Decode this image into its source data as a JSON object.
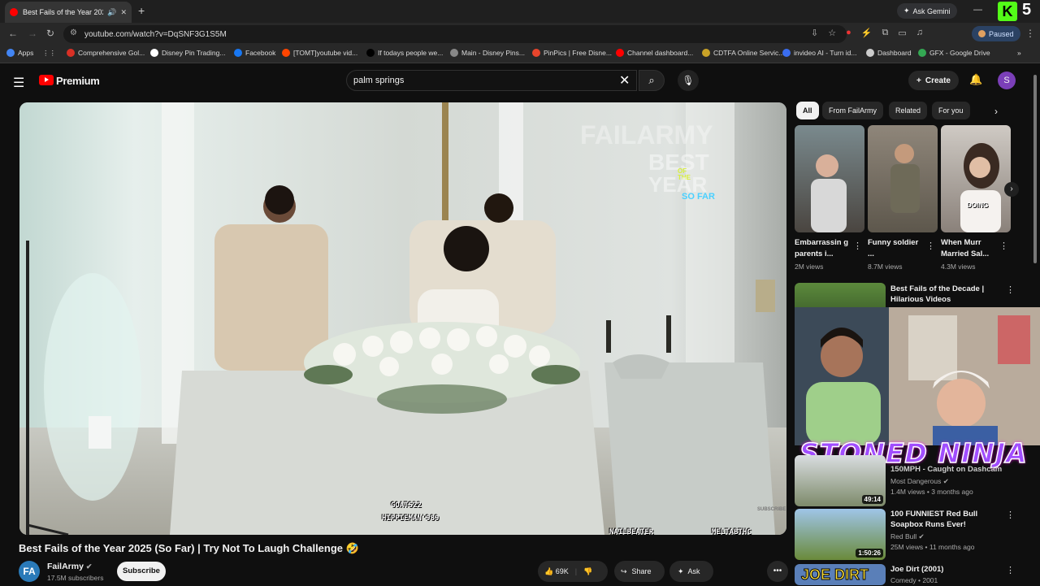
{
  "browser": {
    "tab_title": "Best Fails of the Year 2025 |",
    "url": "youtube.com/watch?v=DqSNF3G1S5M",
    "ask_gemini": "Ask Gemini",
    "paused": "Paused",
    "corner_badge": "5",
    "bookmarks": [
      {
        "label": "Apps",
        "color": "#4285f4"
      },
      {
        "label": "Comprehensive Gol...",
        "color": "#d93025"
      },
      {
        "label": "Disney Pin Trading...",
        "color": "#ffffff"
      },
      {
        "label": "Facebook",
        "color": "#1877f2"
      },
      {
        "label": "[TOMT]youtube vid...",
        "color": "#ff4500"
      },
      {
        "label": "If todays people we...",
        "color": "#000000"
      },
      {
        "label": "Main - Disney Pins...",
        "color": "#888888"
      },
      {
        "label": "PinPics | Free Disne...",
        "color": "#e8452c"
      },
      {
        "label": "Channel dashboard...",
        "color": "#ff0000"
      },
      {
        "label": "CDTFA Online Servic...",
        "color": "#c9a227"
      },
      {
        "label": "invideo AI - Turn id...",
        "color": "#3a6df0"
      },
      {
        "label": "Dashboard",
        "color": "#cccccc"
      },
      {
        "label": "GFX - Google Drive",
        "color": "#34a853"
      }
    ]
  },
  "youtube": {
    "logo_text": "Premium",
    "search_value": "palm springs",
    "create_label": "Create",
    "avatar_letter": "S"
  },
  "video": {
    "overlay_brand": "FAILARMY",
    "overlay_best": "BEST",
    "overlay_of": "OF",
    "overlay_the": "THE",
    "overlay_year": "YEAR",
    "overlay_sofar": "SO FAR",
    "title": "Best Fails of the Year 2025 (So Far) | Try Not To Laugh Challenge 🤣",
    "channel": "FailArmy",
    "subscribers": "17.5M subscribers",
    "subscribe_label": "Subscribe",
    "likes": "69K",
    "share_label": "Share",
    "ask_label": "Ask",
    "subscribe_watermark": "SUBSCRIBE",
    "game_tags": [
      "GOATS22",
      "HIPPIEMAN'989",
      "NAILBEATER",
      "MELTABTHC"
    ]
  },
  "chips": [
    "All",
    "From FailArmy",
    "Related",
    "For you"
  ],
  "shorts": [
    {
      "title": "Embarrassin g parents i...",
      "views": "2M views",
      "caption": ""
    },
    {
      "title": "Funny soldier ...",
      "views": "8.7M views",
      "caption": ""
    },
    {
      "title": "When Murr Married Sal...",
      "views": "4.3M views",
      "caption": "DOING"
    }
  ],
  "recommended": [
    {
      "title": "Best Fails of the Decade | Hilarious Videos",
      "channel": "",
      "meta": "",
      "duration": ""
    },
    {
      "title": "150MPH - Caught on Dashcam",
      "channel": "Most Dangerous",
      "meta": "1.4M views • 3 months ago",
      "duration": "49:14"
    },
    {
      "title": "100 FUNNIEST Red Bull Soapbox Runs Ever!",
      "channel": "Red Bull",
      "meta": "25M views • 11 months ago",
      "duration": "1:50:26"
    },
    {
      "title": "Joe Dirt (2001)",
      "channel": "Comedy • 2001",
      "meta": "",
      "duration": "",
      "thumb_text": "JOE DIRT"
    }
  ],
  "stream_overlay": "STONED NINJA"
}
